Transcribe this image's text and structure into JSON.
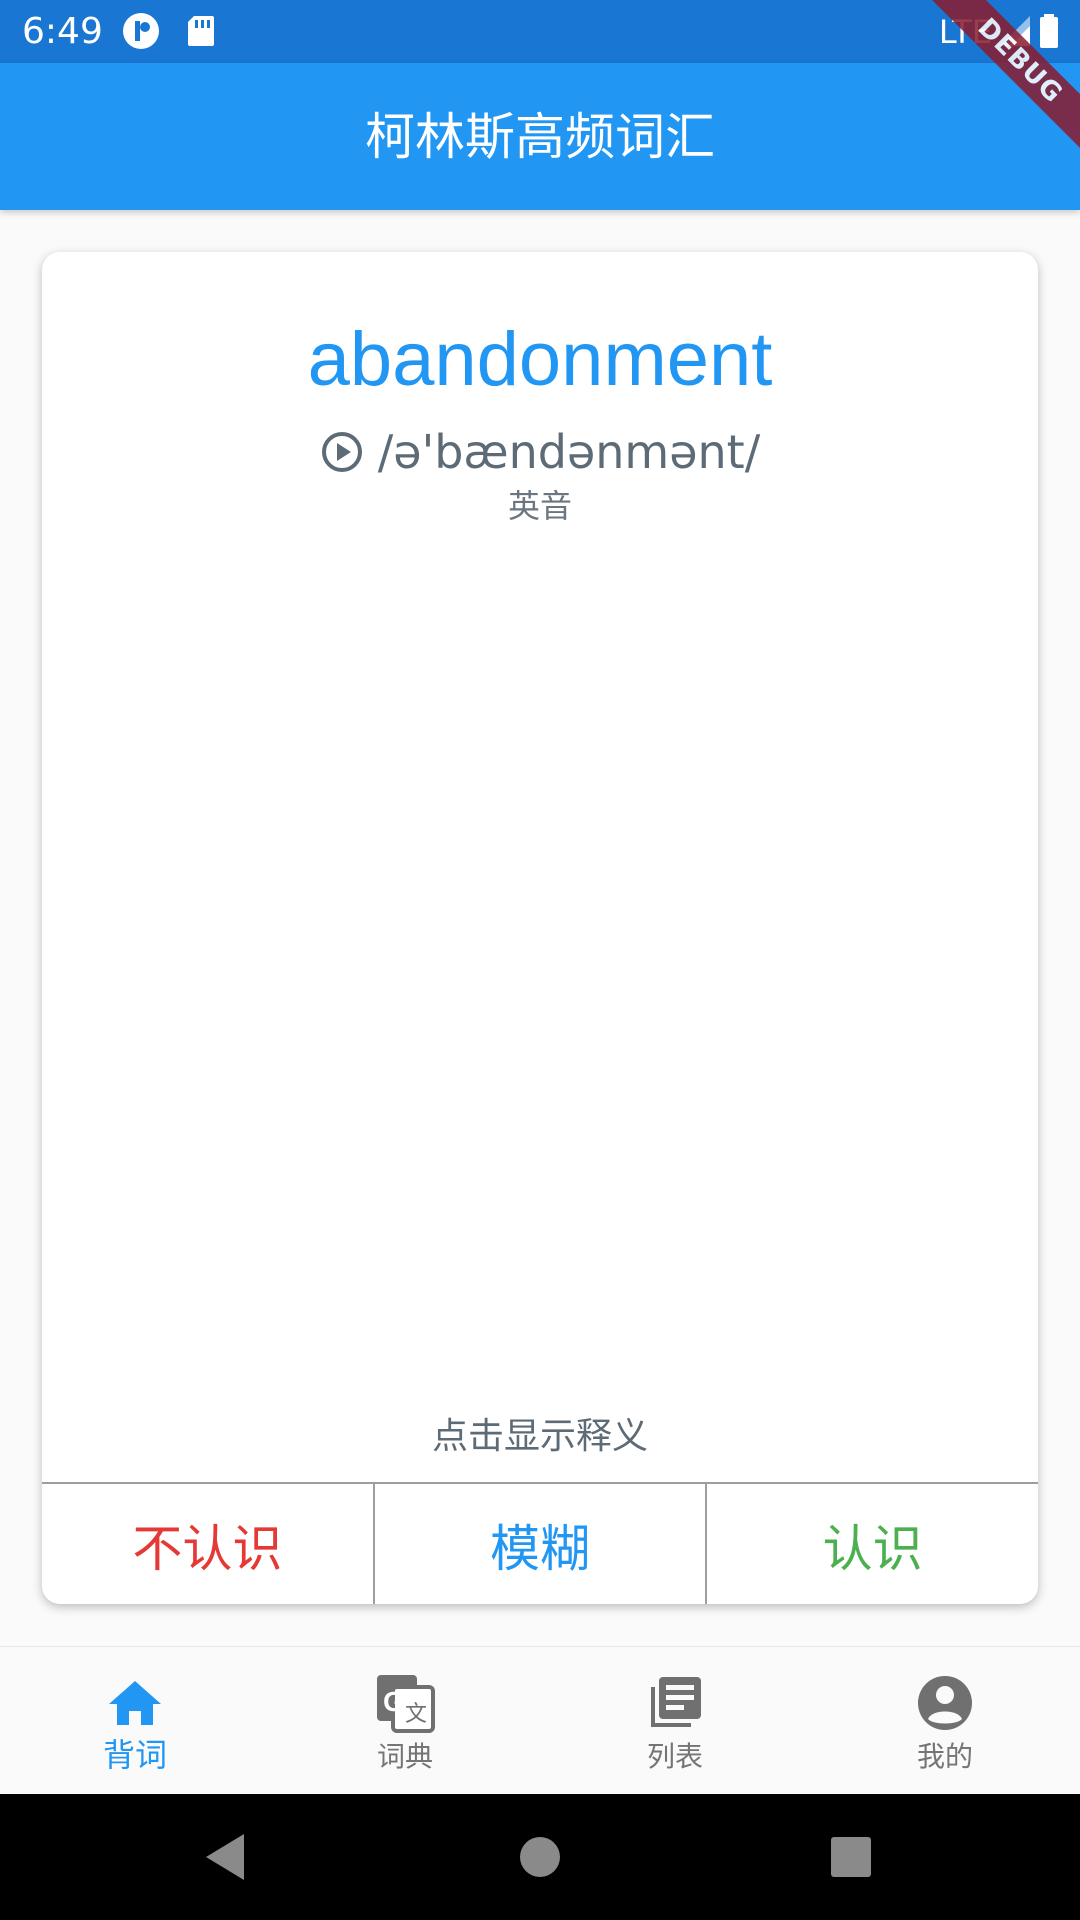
{
  "status_bar": {
    "time": "6:49",
    "network": "LTE",
    "icons": [
      "app-indicator-icon",
      "sd-card-icon",
      "signal-icon",
      "battery-icon"
    ]
  },
  "debug_banner": "DEBUG",
  "app_bar": {
    "title": "柯林斯高频词汇"
  },
  "card": {
    "word": "abandonment",
    "phonetic": "/ə'bændənmənt/",
    "accent": "英音",
    "reveal_hint": "点击显示释义",
    "actions": {
      "unknown": "不认识",
      "fuzzy": "模糊",
      "known": "认识"
    }
  },
  "bottom_nav": {
    "items": [
      {
        "label": "背词",
        "icon": "home-icon",
        "active": true
      },
      {
        "label": "词典",
        "icon": "translate-icon",
        "active": false
      },
      {
        "label": "列表",
        "icon": "library-books-icon",
        "active": false
      },
      {
        "label": "我的",
        "icon": "account-circle-icon",
        "active": false
      }
    ]
  },
  "colors": {
    "primary": "#2196f3",
    "status_bar": "#1976d2",
    "unknown": "#e53935",
    "known": "#4caf50"
  }
}
